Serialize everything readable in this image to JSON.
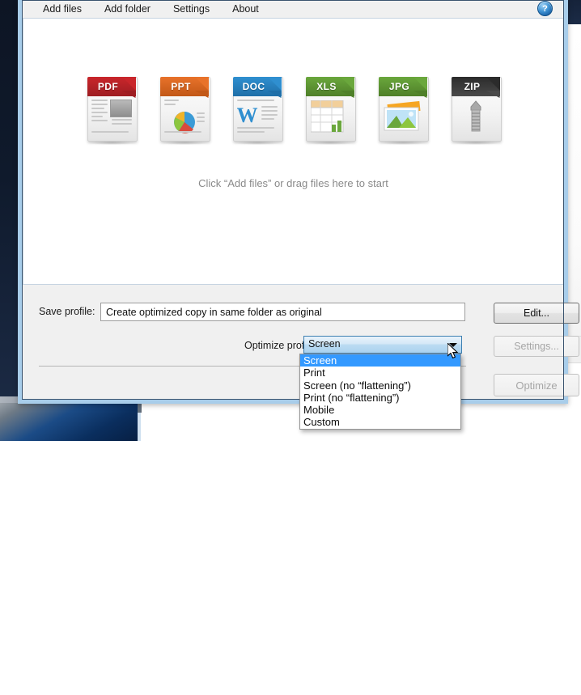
{
  "app": {
    "menu": [
      {
        "label": "Add files",
        "name": "menu-add-files"
      },
      {
        "label": "Add folder",
        "name": "menu-add-folder"
      },
      {
        "label": "Settings",
        "name": "menu-settings"
      },
      {
        "label": "About",
        "name": "menu-about"
      }
    ],
    "help_icon_glyph": "?",
    "help_icon_name": "help-icon"
  },
  "drop_area": {
    "hint": "Click “Add files” or drag files here to start",
    "file_icons": [
      {
        "label": "PDF",
        "color": "#c9262b",
        "color_dark": "#9e1d22"
      },
      {
        "label": "PPT",
        "color": "#e8722a",
        "color_dark": "#c25817"
      },
      {
        "label": "DOC",
        "color": "#2f8fd0",
        "color_dark": "#1f6fa8"
      },
      {
        "label": "XLS",
        "color": "#6aa73c",
        "color_dark": "#4f8029"
      },
      {
        "label": "JPG",
        "color": "#6aa73c",
        "color_dark": "#4f8029"
      },
      {
        "label": "ZIP",
        "color": "#2b2b2b",
        "color_dark": "#4a4a4a"
      }
    ]
  },
  "controls": {
    "save_profile_label": "Save profile:",
    "save_profile_value": "Create optimized copy in same folder as original",
    "edit_button": "Edit...",
    "optimize_profile_label": "Optimize profile:",
    "optimize_profile_value": "Screen",
    "settings_button": "Settings...",
    "optimize_button": "Optimize"
  },
  "dropdown": {
    "selected_index": 0,
    "options": [
      "Screen",
      "Print",
      "Screen (no “flattening”)",
      "Print (no “flattening”)",
      "Mobile",
      "Custom"
    ]
  },
  "colors": {
    "window_frame": "#a8cdea",
    "highlight": "#3399ff",
    "panel_bg": "#f0f0f0"
  }
}
